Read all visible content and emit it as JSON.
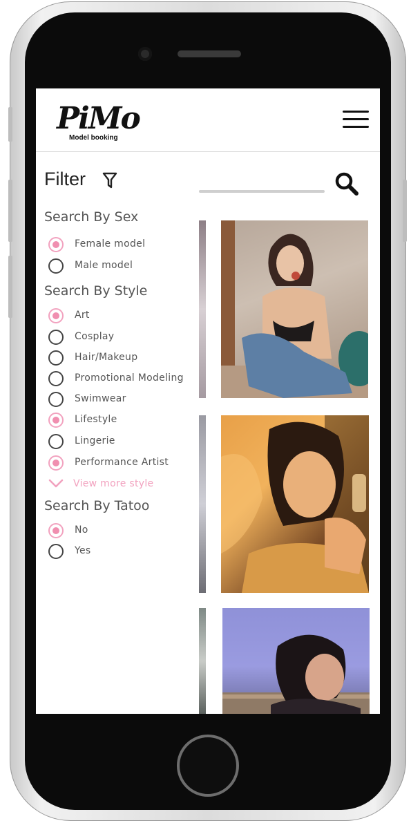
{
  "header": {
    "logo_text": "PiMo",
    "logo_subtitle": "Model booking",
    "menu_icon": "hamburger-icon"
  },
  "filter": {
    "title": "Filter",
    "icon": "funnel-icon",
    "sections": [
      {
        "title": "Search By Sex",
        "options": [
          {
            "label": "Female model",
            "checked": true
          },
          {
            "label": "Male model",
            "checked": false
          }
        ]
      },
      {
        "title": "Search By Style",
        "options": [
          {
            "label": "Art",
            "checked": true
          },
          {
            "label": "Cosplay",
            "checked": false
          },
          {
            "label": "Hair/Makeup",
            "checked": false
          },
          {
            "label": "Promotional Modeling",
            "checked": false
          },
          {
            "label": "Swimwear",
            "checked": false
          },
          {
            "label": "Lifestyle",
            "checked": true
          },
          {
            "label": "Lingerie",
            "checked": false
          },
          {
            "label": "Performance Artist",
            "checked": true
          }
        ],
        "view_more": "View more style"
      },
      {
        "title": "Search By Tatoo",
        "options": [
          {
            "label": "No",
            "checked": true
          },
          {
            "label": "Yes",
            "checked": false
          }
        ]
      }
    ]
  },
  "search": {
    "icon": "search-icon"
  },
  "colors": {
    "accent_pink": "#f08fb0",
    "text_gray": "#555555"
  }
}
